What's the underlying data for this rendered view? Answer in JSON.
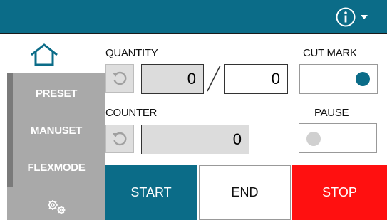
{
  "header": {
    "info_icon": "info-circle-icon",
    "menu_icon": "caret-down-icon",
    "color": "#0b6c88"
  },
  "sidebar": {
    "home_icon": "home-icon",
    "items": [
      {
        "label": "PRESET"
      },
      {
        "label": "MANUSET"
      },
      {
        "label": "FLEXMODE"
      }
    ],
    "settings_icon": "gears-icon"
  },
  "quantity": {
    "label": "QUANTITY",
    "current": "0",
    "target": "0",
    "reset_icon": "reset-icon"
  },
  "counter": {
    "label": "COUNTER",
    "value": "0",
    "reset_icon": "reset-icon"
  },
  "cut_mark": {
    "label": "CUT MARK",
    "state": "on",
    "dot_color": "#0b6c88"
  },
  "pause": {
    "label": "PAUSE",
    "state": "off",
    "dot_color": "#d0d0d0"
  },
  "actions": {
    "start": "START",
    "end": "END",
    "stop": "STOP",
    "start_color": "#0b6c88",
    "stop_color": "#ff1010"
  }
}
